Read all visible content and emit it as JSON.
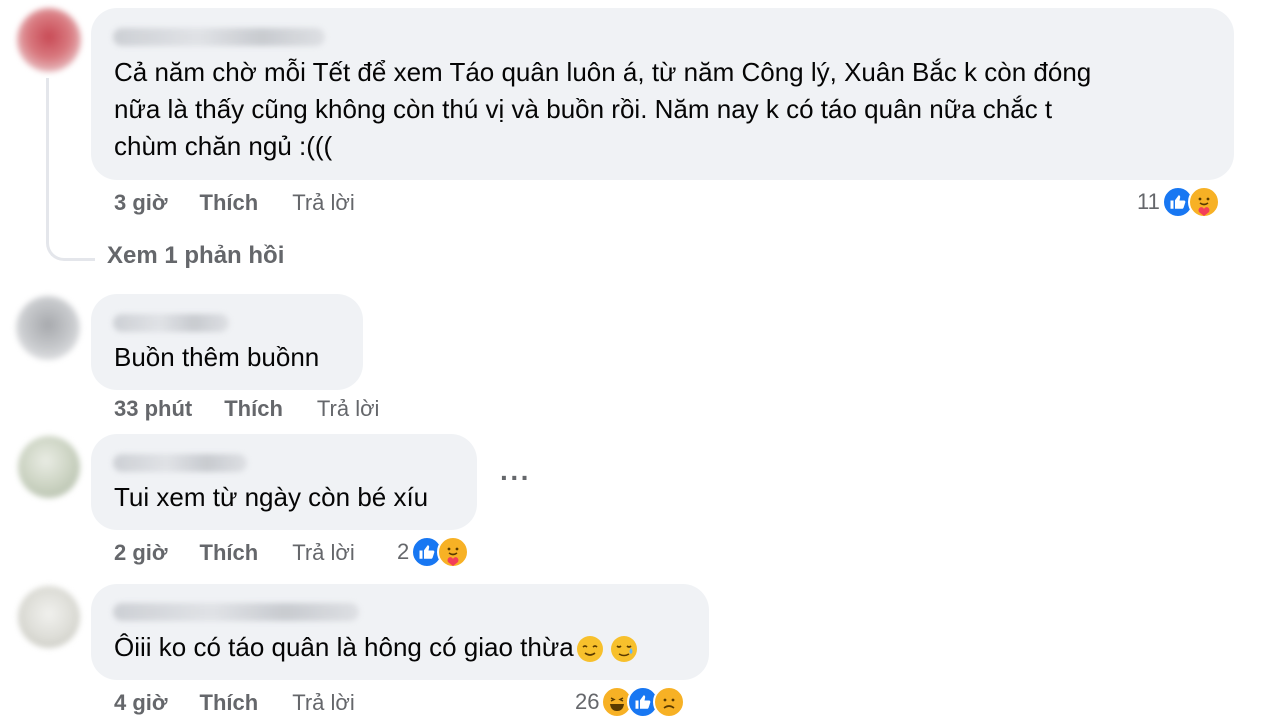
{
  "comments": [
    {
      "text_lines": [
        "Cả năm chờ mỗi Tết để xem Táo quân luôn á, từ năm Công lý, Xuân Bắc k còn đóng",
        "nữa là thấy cũng không còn thú vị và buồn rồi. Năm nay k có táo quân nữa chắc t",
        "chùm chăn ngủ :((("
      ],
      "time": "3 giờ",
      "like_label": "Thích",
      "reply_label": "Trả lời",
      "reaction_count": "11",
      "reactions": [
        "like-icon",
        "care-icon"
      ],
      "view_replies": "Xem 1 phản hồi"
    },
    {
      "text_lines": [
        "Buồn thêm buồnn"
      ],
      "time": "33 phút",
      "like_label": "Thích",
      "reply_label": "Trả lời"
    },
    {
      "text_lines": [
        "Tui xem từ ngày còn bé xíu"
      ],
      "time": "2 giờ",
      "like_label": "Thích",
      "reply_label": "Trả lời",
      "reaction_count": "2",
      "reactions": [
        "like-icon",
        "care-icon"
      ]
    },
    {
      "text_lines": [
        "Ôiii ko có táo quân là hông có giao thừa"
      ],
      "inline_emojis": [
        "relieved-face-icon",
        "smiling-face-with-tear-icon"
      ],
      "time": "4 giờ",
      "like_label": "Thích",
      "reply_label": "Trả lời",
      "reaction_count": "26",
      "reactions": [
        "haha-icon",
        "like-icon",
        "sad-icon"
      ]
    }
  ],
  "colors": {
    "bubble": "#f0f2f5",
    "meta_text": "#65676b",
    "like_blue": "#1877f2",
    "emoji_yellow": "#f7b125"
  }
}
